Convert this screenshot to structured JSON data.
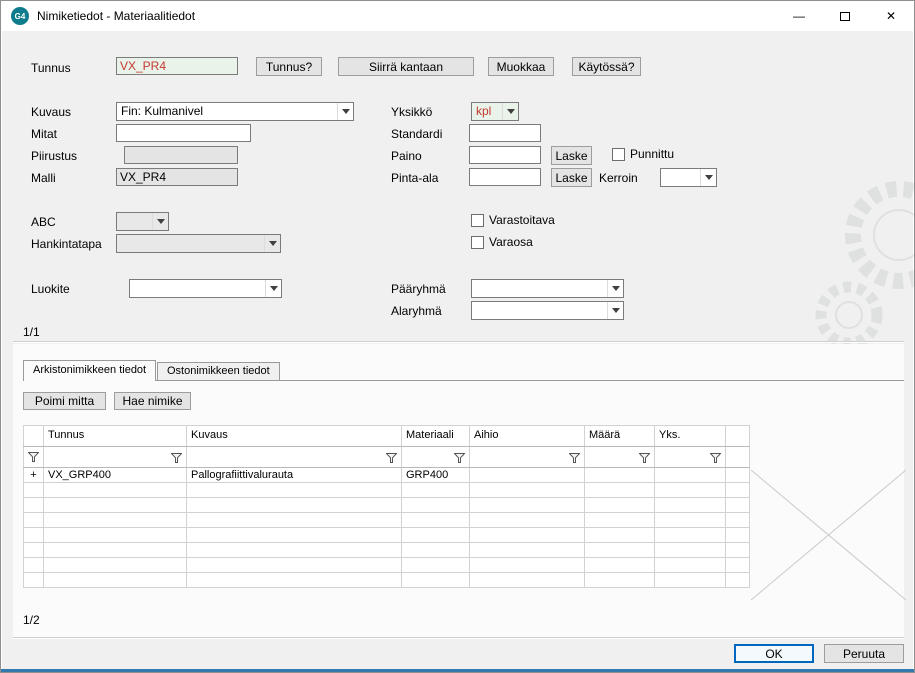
{
  "window": {
    "title": "Nimiketiedot - Materiaalitiedot",
    "icon_text": "G4"
  },
  "toolbar": {
    "tunnus_q": "Tunnus?",
    "siirra_kantaan": "Siirrä kantaan",
    "muokkaa": "Muokkaa",
    "kaytossa_q": "Käytössä?"
  },
  "form": {
    "tunnus": {
      "label": "Tunnus",
      "value": "VX_PR4"
    },
    "kuvaus": {
      "label": "Kuvaus",
      "value": "Fin: Kulmanivel"
    },
    "yksikko": {
      "label": "Yksikkö",
      "value": "kpl"
    },
    "mitat": {
      "label": "Mitat",
      "value": ""
    },
    "standardi": {
      "label": "Standardi",
      "value": ""
    },
    "piirustus": {
      "label": "Piirustus",
      "value": ""
    },
    "paino": {
      "label": "Paino",
      "value": ""
    },
    "pinta_ala": {
      "label": "Pinta-ala",
      "value": ""
    },
    "malli": {
      "label": "Malli",
      "value": "VX_PR4"
    },
    "laske_label": "Laske",
    "punnittu_label": "Punnittu",
    "kerroin_label": "Kerroin",
    "abc_label": "ABC",
    "varastoitava_label": "Varastoitava",
    "hankintatapa_label": "Hankintatapa",
    "varaosa_label": "Varaosa",
    "luokite_label": "Luokite",
    "paaryhma_label": "Pääryhmä",
    "alaryhma_label": "Alaryhmä",
    "pager": "1/1"
  },
  "tabs": [
    {
      "label": "Arkistonimikkeen tiedot",
      "active": true
    },
    {
      "label": "Ostonimikkeen tiedot",
      "active": false
    }
  ],
  "grid": {
    "poimi_mitta": "Poimi mitta",
    "hae_nimike": "Hae nimike",
    "columns": [
      "Tunnus",
      "Kuvaus",
      "Materiaali",
      "Aihio",
      "Määrä",
      "Yks."
    ],
    "rows": [
      {
        "marker": "+",
        "tunnus": "VX_GRP400",
        "kuvaus": "Pallografiittivalurauta",
        "materiaali": "GRP400",
        "aihio": "",
        "maara": "",
        "yks": ""
      }
    ],
    "pager": "1/2"
  },
  "footer": {
    "ok": "OK",
    "peruuta": "Peruuta"
  },
  "colors": {
    "highlight_field_bg": "#e9f3ea",
    "highlight_field_text": "#c4392e",
    "default_button_border": "#0067c0",
    "titlebar_icon_bg": "#0e7c8c"
  }
}
